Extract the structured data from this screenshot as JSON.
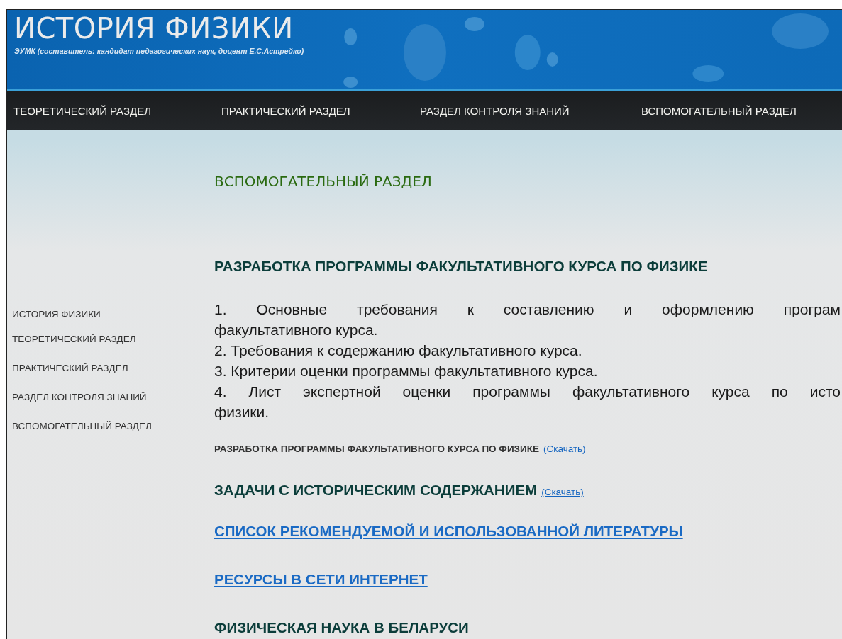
{
  "header": {
    "title": "ИСТОРИЯ ФИЗИКИ",
    "subtitle": "ЭУМК (составитель: кандидат педагогических наук, доцент Е.С.Астрейко)"
  },
  "nav": [
    {
      "label": "ТЕОРЕТИЧЕСКИЙ РАЗДЕЛ"
    },
    {
      "label": "ПРАКТИЧЕСКИЙ РАЗДЕЛ"
    },
    {
      "label": "РАЗДЕЛ КОНТРОЛЯ ЗНАНИЙ"
    },
    {
      "label": "ВСПОМОГАТЕЛЬНЫЙ РАЗДЕЛ"
    }
  ],
  "sidebar": {
    "items": [
      {
        "label": "ИСТОРИЯ ФИЗИКИ"
      },
      {
        "label": "ТЕОРЕТИЧЕСКИЙ РАЗДЕЛ"
      },
      {
        "label": "ПРАКТИЧЕСКИЙ РАЗДЕЛ"
      },
      {
        "label": "РАЗДЕЛ КОНТРОЛЯ ЗНАНИЙ"
      },
      {
        "label": "ВСПОМОГАТЕЛЬНЫЙ РАЗДЕЛ"
      }
    ]
  },
  "content": {
    "page_title": "ВСПОМОГАТЕЛЬНЫЙ РАЗДЕЛ",
    "blocks": [
      {
        "kind": "heading",
        "text": "РАЗРАБОТКА ПРОГРАММЫ ФАКУЛЬТАТИВНОГО КУРСА ПО ФИЗИКЕ"
      },
      {
        "kind": "list",
        "items": [
          {
            "lines": [
              "1. Основные требования к составлению и оформлению програм",
              "факультативного курса."
            ]
          },
          {
            "lines": [
              "2. Требования к содержанию факультативного курса."
            ]
          },
          {
            "lines": [
              "3. Критерии оценки программы факультативного курса."
            ]
          },
          {
            "lines": [
              "4. Лист экспертной оценки программы факультативного курса по исто",
              "физики."
            ]
          }
        ]
      },
      {
        "kind": "small",
        "text": "РАЗРАБОТКА ПРОГРАММЫ ФАКУЛЬТАТИВНОГО КУРСА ПО ФИЗИКЕ",
        "link": "(Скачать)"
      },
      {
        "kind": "heading",
        "text": "ЗАДАЧИ С ИСТОРИЧЕСКИМ СОДЕРЖАНИЕМ",
        "link": "(Скачать)"
      },
      {
        "kind": "link_heading",
        "text": "СПИСОК РЕКОМЕНДУЕМОЙ И ИСПОЛЬЗОВАННОЙ ЛИТЕРАТУРЫ"
      },
      {
        "kind": "link_heading",
        "text": "РЕСУРСЫ В СЕТИ ИНТЕРНЕТ"
      },
      {
        "kind": "heading",
        "text": "ФИЗИЧЕСКАЯ НАУКА В БЕЛАРУСИ"
      }
    ]
  }
}
